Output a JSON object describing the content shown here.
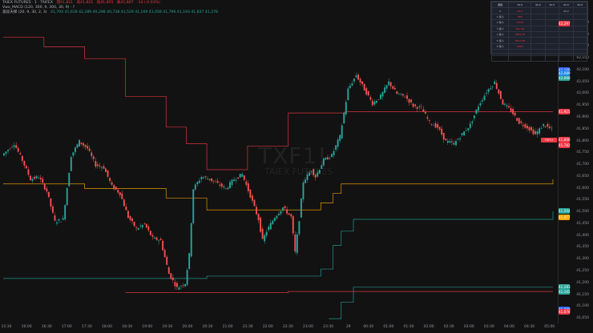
{
  "header": {
    "line1": "TAIEX FUTURES · 1 · TAIFEX",
    "line1_o": "開41,821",
    "line1_h": "高41,821",
    "line1_l": "低41,805",
    "line1_c": "收41,807",
    "line1_chg": "-14 (-0.03%)",
    "line2": "Vwo_MACD (120, 300, 9, 300, 30, 9) · ?",
    "line3": "波段天梯 (20, 9, 30, 2, 3)",
    "line3_values": "41,793  41,618  42,289  40,298  40,738  41,529  41,169  41,058  41,796  41,193  41,827  41,278"
  },
  "watermark": {
    "symbol": "TXF1!",
    "name": "TAIEX FUTURES"
  },
  "currency": "TWD",
  "table": {
    "headers": [
      "關鍵",
      "42.0",
      "42.0",
      "42.0",
      "42.0",
      "42.0"
    ],
    "rows": [
      [
        "K",
        "42.0",
        "",
        "",
        "40.0",
        ""
      ],
      [
        "1 保小",
        "384",
        "",
        "",
        "",
        ""
      ],
      [
        "2 保小",
        "3,024",
        "",
        "",
        "",
        ""
      ],
      [
        "3 保小",
        "441.98",
        "",
        "",
        "",
        ""
      ],
      [
        "4 保小",
        "1581.20",
        "",
        "",
        "",
        ""
      ],
      [
        "5 保小",
        "3027.58",
        "",
        "",
        "",
        ""
      ],
      [
        "6 保小",
        "2020",
        "",
        "",
        "",
        ""
      ],
      [
        "",
        "",
        "",
        "",
        "",
        ""
      ],
      [
        "",
        "",
        "",
        "",
        "",
        ""
      ]
    ]
  },
  "price_badges": [
    {
      "value": "42,297",
      "color": "#f23645",
      "y": 42297
    },
    {
      "value": "42,100",
      "color": "#2962ff",
      "y": 42100
    },
    {
      "value": "42,068",
      "color": "#26a69a",
      "y": 42068
    },
    {
      "value": "42,089",
      "color": "#1e88e5",
      "y": 42089
    },
    {
      "value": "41,925",
      "color": "#f23645",
      "y": 41925
    },
    {
      "value": "41,806",
      "color": "#f23645",
      "y": 41806
    },
    {
      "value": "41,782",
      "color": "#f23645",
      "y": 41782
    },
    {
      "value": "41,477",
      "color": "#f7a600",
      "y": 41477
    },
    {
      "value": "41,504",
      "color": "#26a69a",
      "y": 41504
    },
    {
      "value": "41,183",
      "color": "#26a69a",
      "y": 41183
    },
    {
      "value": "41,165",
      "color": "#26a69a",
      "y": 41165
    },
    {
      "value": "41,089",
      "color": "#2962ff",
      "y": 41089
    },
    {
      "value": "41,078",
      "color": "#f23645",
      "y": 41078
    }
  ],
  "current_price_label": "TXF1!",
  "chart_data": {
    "type": "candlestick",
    "y_ticks": [
      42300,
      42250,
      42200,
      42150,
      42100,
      42050,
      42000,
      41950,
      41900,
      41850,
      41800,
      41750,
      41700,
      41650,
      41600,
      41550,
      41500,
      41450,
      41400,
      41350,
      41300,
      41250,
      41200,
      41150,
      41100,
      41050
    ],
    "y_tick_labels": [
      "42,300",
      "42,250",
      "42,200",
      "42,150",
      "42,100",
      "42,050",
      "42,000",
      "41,950",
      "41,900",
      "41,850",
      "41,800",
      "41,750",
      "41,700",
      "41,650",
      "41,600",
      "41,550",
      "41,500",
      "41,450",
      "41,400",
      "41,350",
      "41,300",
      "41,250",
      "41,200",
      "41,150",
      "41,100",
      "41,050"
    ],
    "ylim": [
      41030,
      42330
    ],
    "x_ticks": [
      "15:30",
      "16:00",
      "16:30",
      "17:00",
      "17:30",
      "18:00",
      "18:30",
      "19:00",
      "19:30",
      "20:00",
      "20:30",
      "21:00",
      "21:30",
      "22:00",
      "22:30",
      "23:00",
      "23:30",
      "29",
      "00:30",
      "01:00",
      "01:30",
      "02:00",
      "02:30",
      "03:00",
      "03:30",
      "04:00",
      "04:30",
      "05:00"
    ],
    "price_path": [
      [
        0,
        41740
      ],
      [
        6,
        41790
      ],
      [
        10,
        41720
      ],
      [
        14,
        41640
      ],
      [
        18,
        41650
      ],
      [
        22,
        41590
      ],
      [
        26,
        41460
      ],
      [
        30,
        41470
      ],
      [
        34,
        41740
      ],
      [
        38,
        41800
      ],
      [
        42,
        41770
      ],
      [
        46,
        41700
      ],
      [
        50,
        41690
      ],
      [
        54,
        41610
      ],
      [
        58,
        41580
      ],
      [
        62,
        41480
      ],
      [
        66,
        41430
      ],
      [
        70,
        41450
      ],
      [
        74,
        41390
      ],
      [
        78,
        41380
      ],
      [
        82,
        41240
      ],
      [
        86,
        41180
      ],
      [
        90,
        41200
      ],
      [
        92,
        41320
      ],
      [
        94,
        41600
      ],
      [
        98,
        41650
      ],
      [
        102,
        41640
      ],
      [
        106,
        41620
      ],
      [
        110,
        41600
      ],
      [
        114,
        41640
      ],
      [
        118,
        41660
      ],
      [
        122,
        41570
      ],
      [
        126,
        41470
      ],
      [
        128,
        41380
      ],
      [
        130,
        41420
      ],
      [
        134,
        41480
      ],
      [
        138,
        41520
      ],
      [
        142,
        41480
      ],
      [
        144,
        41330
      ],
      [
        146,
        41470
      ],
      [
        148,
        41630
      ],
      [
        152,
        41680
      ],
      [
        154,
        41650
      ],
      [
        158,
        41720
      ],
      [
        162,
        41740
      ],
      [
        166,
        41820
      ],
      [
        170,
        42020
      ],
      [
        174,
        42080
      ],
      [
        178,
        42020
      ],
      [
        182,
        41960
      ],
      [
        186,
        41990
      ],
      [
        190,
        42050
      ],
      [
        194,
        42000
      ],
      [
        198,
        41990
      ],
      [
        202,
        41950
      ],
      [
        206,
        41940
      ],
      [
        210,
        41880
      ],
      [
        214,
        41860
      ],
      [
        218,
        41800
      ],
      [
        222,
        41790
      ],
      [
        226,
        41830
      ],
      [
        230,
        41870
      ],
      [
        234,
        41950
      ],
      [
        238,
        42010
      ],
      [
        242,
        42050
      ],
      [
        246,
        41960
      ],
      [
        250,
        41930
      ],
      [
        254,
        41880
      ],
      [
        258,
        41860
      ],
      [
        262,
        41830
      ],
      [
        266,
        41870
      ],
      [
        270,
        41850
      ]
    ],
    "ladder_lines": [
      {
        "name": "",
        "color": "#f23645",
        "steps": [
          [
            0,
            42240
          ],
          [
            20,
            42200
          ],
          [
            40,
            42150
          ],
          [
            60,
            41990
          ],
          [
            80,
            41860
          ],
          [
            90,
            41790
          ],
          [
            100,
            41680
          ],
          [
            120,
            41780
          ],
          [
            140,
            41920
          ],
          [
            150,
            41920
          ],
          [
            168,
            41925
          ],
          [
            200,
            41925
          ],
          [
            270,
            41925
          ]
        ]
      },
      {
        "name": "",
        "color": "#f7a600",
        "steps": [
          [
            0,
            41620
          ],
          [
            40,
            41600
          ],
          [
            80,
            41560
          ],
          [
            100,
            41510
          ],
          [
            140,
            41510
          ],
          [
            156,
            41540
          ],
          [
            162,
            41580
          ],
          [
            166,
            41620
          ],
          [
            270,
            41640
          ]
        ]
      },
      {
        "name": "",
        "color": "#26a69a",
        "steps": [
          [
            0,
            41220
          ],
          [
            40,
            41220
          ],
          [
            100,
            41230
          ],
          [
            140,
            41230
          ],
          [
            156,
            41260
          ],
          [
            162,
            41360
          ],
          [
            166,
            41420
          ],
          [
            172,
            41470
          ],
          [
            270,
            41504
          ]
        ]
      },
      {
        "name": "",
        "color": "#f23645",
        "steps": [
          [
            60,
            41160
          ],
          [
            100,
            41160
          ],
          [
            140,
            41165
          ],
          [
            170,
            41165
          ],
          [
            270,
            41165
          ]
        ]
      },
      {
        "name": "",
        "color": "#26a69a",
        "steps": [
          [
            160,
            41050
          ],
          [
            166,
            41120
          ],
          [
            172,
            41183
          ],
          [
            270,
            41183
          ]
        ]
      }
    ]
  }
}
